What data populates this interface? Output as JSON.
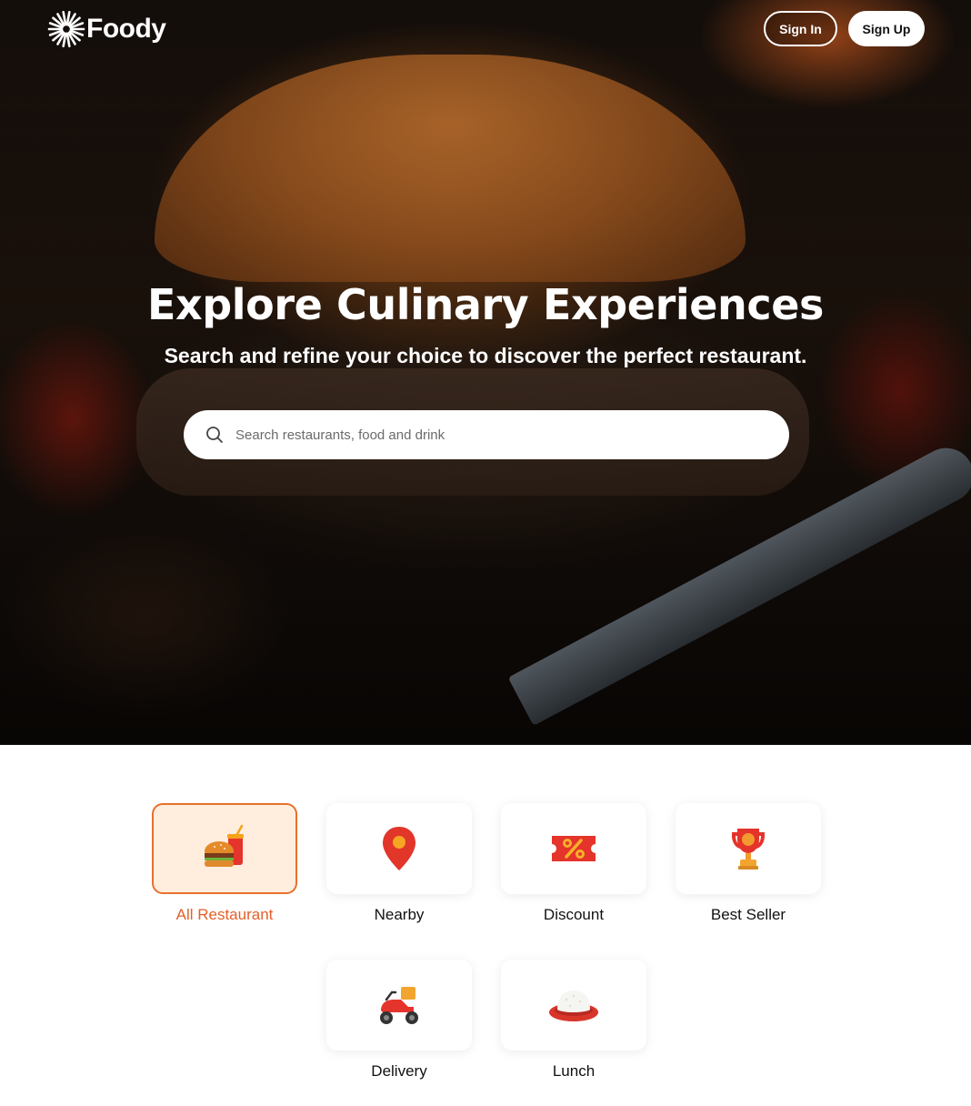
{
  "brand": {
    "name": "Foody"
  },
  "header": {
    "sign_in_label": "Sign In",
    "sign_up_label": "Sign Up"
  },
  "hero": {
    "title": "Explore Culinary Experiences",
    "subtitle": "Search and refine your choice to discover the perfect restaurant."
  },
  "search": {
    "placeholder": "Search restaurants, food and drink",
    "value": ""
  },
  "categories": {
    "items": [
      {
        "label": "All Restaurant",
        "icon": "burger-drink-icon",
        "active": true
      },
      {
        "label": "Nearby",
        "icon": "location-pin-icon",
        "active": false
      },
      {
        "label": "Discount",
        "icon": "discount-ticket-icon",
        "active": false
      },
      {
        "label": "Best Seller",
        "icon": "trophy-icon",
        "active": false
      },
      {
        "label": "Delivery",
        "icon": "scooter-icon",
        "active": false
      },
      {
        "label": "Lunch",
        "icon": "rice-plate-icon",
        "active": false
      }
    ]
  },
  "colors": {
    "accent": "#e2602a",
    "accent_bg": "#ffeede",
    "hero_text": "#ffffff"
  }
}
